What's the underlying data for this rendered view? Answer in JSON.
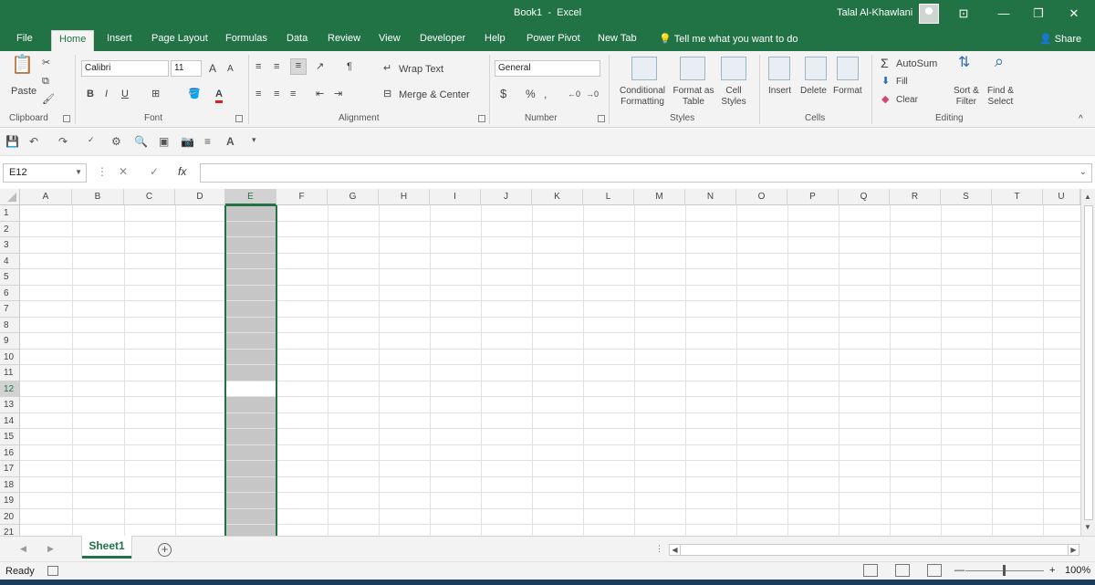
{
  "title": {
    "book": "Book1",
    "dash": "-",
    "app": "Excel",
    "user": "Talal Al-Khawlani",
    "restore": "❐",
    "minimize": "—",
    "maximize": "□",
    "close": "✕",
    "ribbon_display": "⊡"
  },
  "tabs": [
    "File",
    "Home",
    "Insert",
    "Page Layout",
    "Formulas",
    "Data",
    "Review",
    "View",
    "Developer",
    "Help",
    "Power Pivot",
    "New Tab"
  ],
  "tell_me": "Tell me what you want to do",
  "share": "Share",
  "ribbon": {
    "clipboard": {
      "group": "Clipboard",
      "paste": "Paste"
    },
    "font": {
      "group": "Font",
      "name": "Calibri",
      "size": "11",
      "bold": "B",
      "italic": "I",
      "underline": "U",
      "grow": "A",
      "shrink": "A",
      "font_color": "A",
      "font_color_hex": "#e02020"
    },
    "alignment": {
      "group": "Alignment",
      "wrap_text": "Wrap Text",
      "merge_center": "Merge & Center"
    },
    "number": {
      "group": "Number",
      "format": "General",
      "currency": "$",
      "percent": "%",
      "comma": ","
    },
    "styles": {
      "group": "Styles",
      "conditional": [
        "Conditional",
        "Formatting"
      ],
      "format_table": [
        "Format as",
        "Table"
      ],
      "cell_styles": [
        "Cell",
        "Styles"
      ]
    },
    "cells": {
      "group": "Cells",
      "insert": "Insert",
      "delete": "Delete",
      "format": "Format"
    },
    "editing": {
      "group": "Editing",
      "autosum": "AutoSum",
      "fill": "Fill",
      "clear": "Clear",
      "sort_filter": [
        "Sort &",
        "Filter"
      ],
      "find_select": [
        "Find &",
        "Select"
      ]
    }
  },
  "formula_bar": {
    "name_box": "E12",
    "fx": "fx",
    "value": ""
  },
  "grid": {
    "columns": [
      "A",
      "B",
      "C",
      "D",
      "E",
      "F",
      "G",
      "H",
      "I",
      "J",
      "K",
      "L",
      "M",
      "N",
      "O",
      "P",
      "Q",
      "R",
      "S",
      "T",
      "U"
    ],
    "rows": [
      "1",
      "2",
      "3",
      "4",
      "5",
      "6",
      "7",
      "8",
      "9",
      "10",
      "11",
      "12",
      "13",
      "14",
      "15",
      "16",
      "17",
      "18",
      "19",
      "20",
      "21"
    ],
    "selected_column": "E",
    "active_row": "12"
  },
  "sheets": [
    "Sheet1"
  ],
  "status": {
    "ready": "Ready",
    "zoom": "100%",
    "minus": "—",
    "plus": "+"
  },
  "colors": {
    "excel_green": "#217346",
    "selection_gray": "#c6c6c6"
  }
}
